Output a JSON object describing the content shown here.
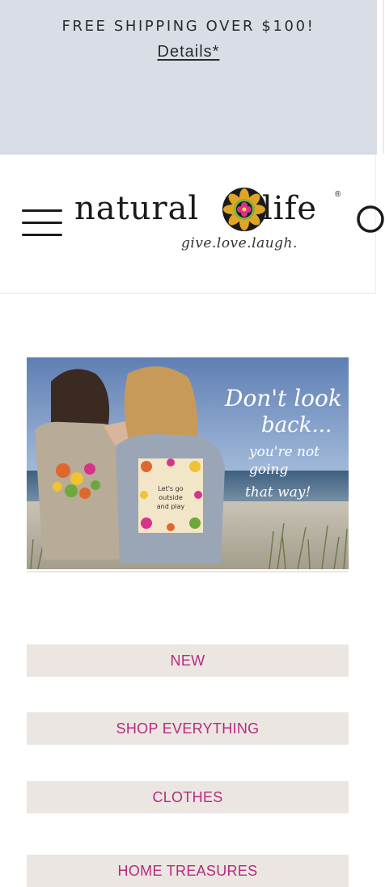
{
  "promo": {
    "text": "FREE SHIPPING OVER $100!",
    "link": "Details*"
  },
  "header": {
    "logo": {
      "word_left": "natural",
      "word_right": "life",
      "tagline": "give.love.laugh."
    },
    "icons": [
      "menu-icon",
      "search-icon"
    ]
  },
  "hero": {
    "headline_lines": [
      "Don't look",
      "back..."
    ],
    "sub_lines": [
      "you're not",
      "going",
      "that way!"
    ],
    "shirt_text_lines": [
      "Let's go",
      "outside",
      "and play"
    ]
  },
  "nav": {
    "items": [
      {
        "label": "NEW"
      },
      {
        "label": "SHOP EVERYTHING"
      },
      {
        "label": "CLOTHES"
      },
      {
        "label": "HOME TREASURES"
      }
    ]
  },
  "colors": {
    "promo_bg": "#d9dee6",
    "nav_bg": "#ebe6e1",
    "nav_text": "#b32c7d"
  }
}
